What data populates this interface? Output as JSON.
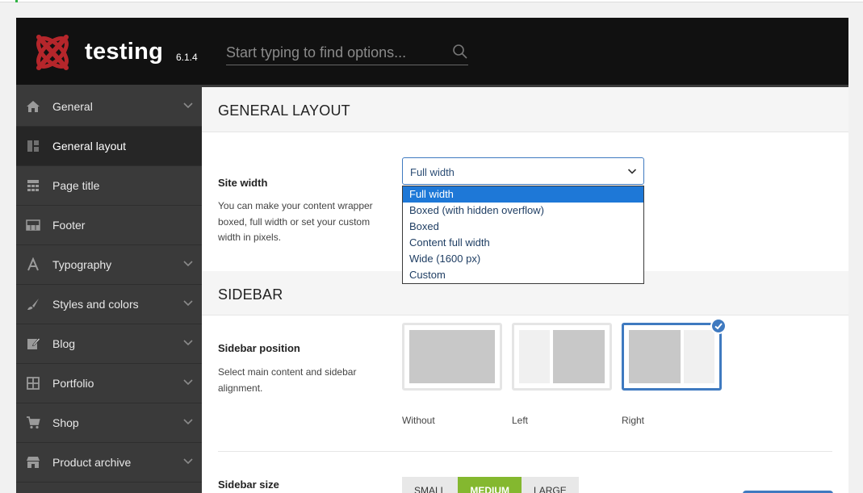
{
  "header": {
    "app_name": "testing",
    "version": "6.1.4",
    "search_placeholder": "Start typing to find options..."
  },
  "sidebar": {
    "items": [
      {
        "label": "General",
        "icon": "home-icon",
        "expandable": true,
        "active": false
      },
      {
        "label": "General layout",
        "icon": "layout-icon",
        "expandable": false,
        "active": true
      },
      {
        "label": "Page title",
        "icon": "page-title-icon",
        "expandable": false,
        "active": false
      },
      {
        "label": "Footer",
        "icon": "footer-icon",
        "expandable": false,
        "active": false
      },
      {
        "label": "Typography",
        "icon": "typography-icon",
        "expandable": true,
        "active": false
      },
      {
        "label": "Styles and colors",
        "icon": "brush-icon",
        "expandable": true,
        "active": false
      },
      {
        "label": "Blog",
        "icon": "edit-icon",
        "expandable": true,
        "active": false
      },
      {
        "label": "Portfolio",
        "icon": "grid-icon",
        "expandable": true,
        "active": false
      },
      {
        "label": "Shop",
        "icon": "cart-icon",
        "expandable": true,
        "active": false
      },
      {
        "label": "Product archive",
        "icon": "store-icon",
        "expandable": true,
        "active": false
      }
    ]
  },
  "sections": {
    "general_layout": {
      "title": "GENERAL LAYOUT",
      "site_width": {
        "label": "Site width",
        "description": "You can make your content wrapper boxed, full width or set your custom width in pixels.",
        "selected": "Full width",
        "options": [
          "Full width",
          "Boxed (with hidden overflow)",
          "Boxed",
          "Content full width",
          "Wide (1600 px)",
          "Custom"
        ]
      }
    },
    "sidebar": {
      "title": "SIDEBAR",
      "position": {
        "label": "Sidebar position",
        "description": "Select main content and sidebar alignment.",
        "options": [
          "Without",
          "Left",
          "Right"
        ],
        "selected": "Right"
      },
      "size": {
        "label": "Sidebar size",
        "options": [
          "SMALL",
          "MEDIUM",
          "LARGE"
        ],
        "selected": "MEDIUM"
      }
    }
  },
  "colors": {
    "header_bg": "#111111",
    "sidebar_bg": "#3a3a3a",
    "accent_blue": "#3f7ac0",
    "selected_option": "#1e78d7",
    "segment_active": "#84b82f",
    "logo_red": "#b5262b"
  }
}
